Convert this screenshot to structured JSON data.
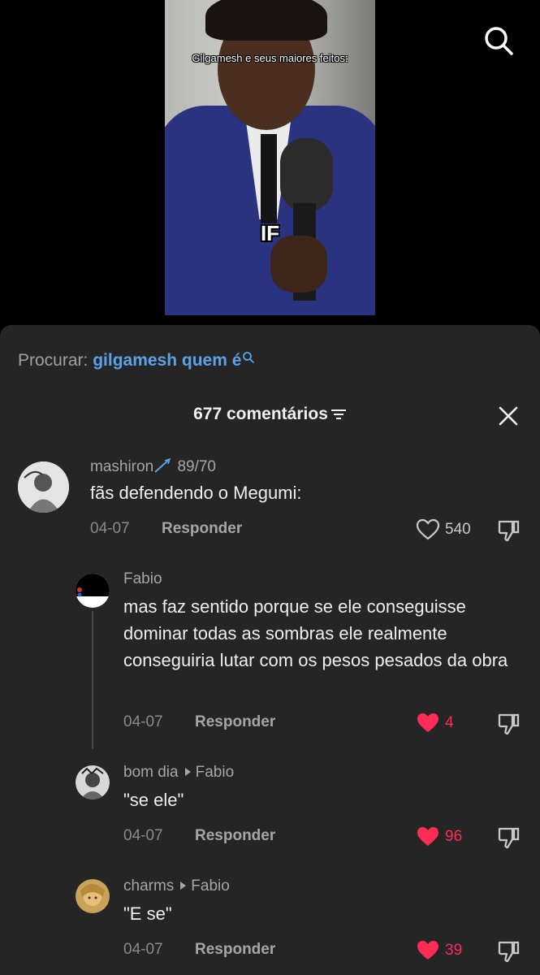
{
  "video": {
    "overlay_title": "Gilgamesh e seus maiores feitos:",
    "overlay_caption": "IF",
    "search_icon": "search-icon"
  },
  "search_suggestion": {
    "label": "Procurar:",
    "query": "gilgamesh quem é",
    "icon": "search-icon"
  },
  "comments": {
    "title": "677 comentários",
    "sort_icon": "sort-icon",
    "close_icon": "close-icon",
    "items": [
      {
        "username": "mashiron",
        "user_badge": "89/70",
        "text": "fãs defendendo o Megumi:",
        "date": "04-07",
        "reply_label": "Responder",
        "likes": "540",
        "liked": false
      },
      {
        "username": "Fabio",
        "text": "mas faz sentido porque se ele conseguisse dominar todas as sombras ele realmente conseguiria lutar com os pesos pesados da obra",
        "date": "04-07",
        "reply_label": "Responder",
        "likes": "4",
        "liked": true
      },
      {
        "username": "bom dia",
        "reply_to": "Fabio",
        "text": "\"se ele\"",
        "date": "04-07",
        "reply_label": "Responder",
        "likes": "96",
        "liked": true
      },
      {
        "username": "charms",
        "reply_to": "Fabio",
        "text": "\"E se\"",
        "date": "04-07",
        "reply_label": "Responder",
        "likes": "39",
        "liked": true
      }
    ]
  },
  "colors": {
    "panel_bg": "#252525",
    "link_blue": "#5aa3e8",
    "like_red": "#ff2d55"
  }
}
